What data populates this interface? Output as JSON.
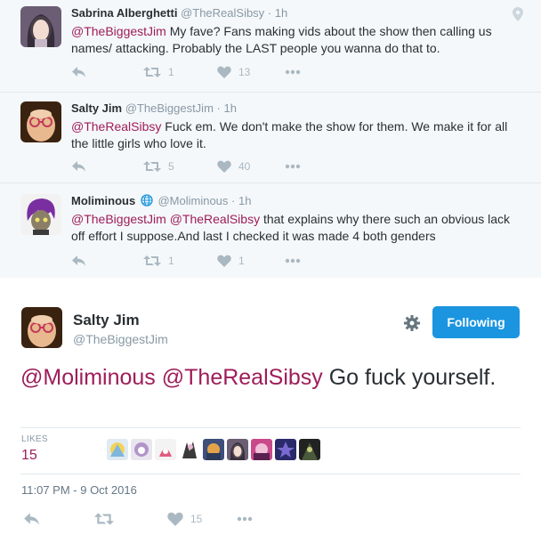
{
  "thread": [
    {
      "name": "Sabrina Alberghetti",
      "handle": "@TheRealSibsy",
      "dot": "·",
      "time": "1h",
      "mention": "@TheBiggestJim",
      "text": " My fave? Fans making vids about the show then calling us names/ attacking. Probably the LAST people you wanna do that to.",
      "retweets": "1",
      "likes": "13"
    },
    {
      "name": "Salty Jim",
      "handle": "@TheBiggestJim",
      "dot": "·",
      "time": "1h",
      "mention": "@TheRealSibsy",
      "text": " Fuck em. We don't make the show for them. We make it for all the little girls who love it.",
      "retweets": "5",
      "likes": "40"
    },
    {
      "name": "Moliminous",
      "handle": "@Moliminous",
      "dot": "·",
      "time": "1h",
      "mention1": "@TheBiggestJim",
      "mention2": "@TheRealSibsy",
      "text": " that explains why there such an obvious lack off effort I suppose.And last I checked it was made 4 both genders",
      "retweets": "1",
      "likes": "1"
    }
  ],
  "main": {
    "name": "Salty Jim",
    "handle": "@TheBiggestJim",
    "follow_label": "Following",
    "mention1": "@Moliminous",
    "mention2": "@TheRealSibsy",
    "text": " Go fuck yourself.",
    "likes_label": "LIKES",
    "likes_count": "15",
    "timestamp": "11:07 PM - 9 Oct 2016",
    "action_likes": "15"
  },
  "colors": {
    "accent": "#9d1d5a",
    "follow_blue": "#1b95e0",
    "muted": "#8899a6"
  }
}
